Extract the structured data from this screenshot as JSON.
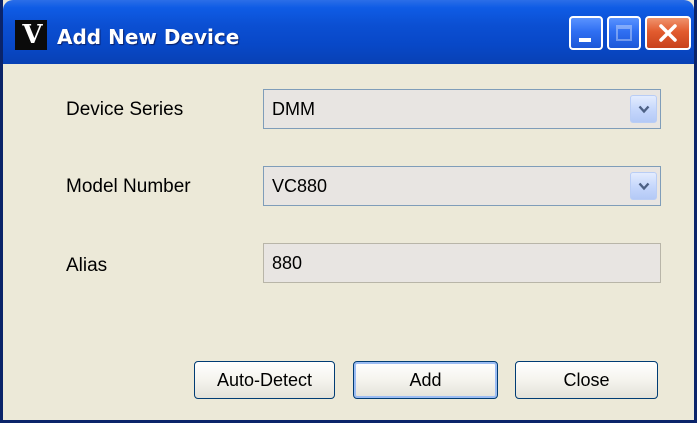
{
  "window": {
    "title": "Add New Device",
    "logo_letter": "V",
    "controls": [
      "minimize-icon",
      "maximize-icon",
      "close-icon"
    ]
  },
  "form": {
    "device_series": {
      "label": "Device Series",
      "value": "DMM",
      "type": "dropdown"
    },
    "model_number": {
      "label": "Model Number",
      "value": "VC880",
      "type": "dropdown"
    },
    "alias": {
      "label": "Alias",
      "value": "880",
      "type": "text"
    }
  },
  "buttons": {
    "auto_detect": "Auto-Detect",
    "add": "Add",
    "close": "Close"
  },
  "colors": {
    "titlebar": "#0b4fd2",
    "window_background": "#ece9d8",
    "close_button": "#e25b2e"
  }
}
